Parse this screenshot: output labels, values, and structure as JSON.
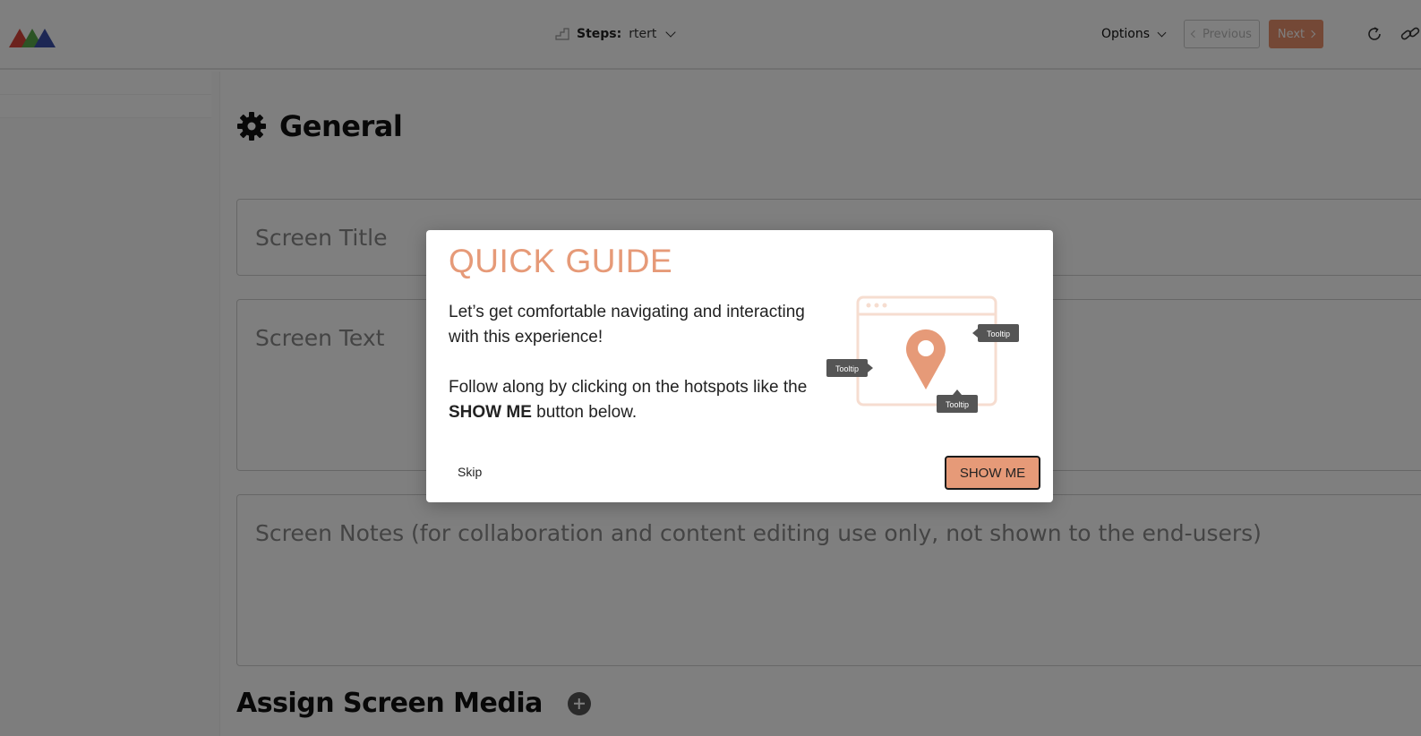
{
  "header": {
    "steps_label": "Steps:",
    "steps_value": "rtert",
    "options_label": "Options",
    "previous_label": "Previous",
    "next_label": "Next"
  },
  "main": {
    "section_title": "General",
    "screen_title_placeholder": "Screen Title",
    "screen_text_placeholder": "Screen Text",
    "screen_notes_placeholder": "Screen Notes (for collaboration and content editing use only, not shown to the end-users)",
    "media_title": "Assign Screen Media"
  },
  "guide": {
    "title": "QUICK GUIDE",
    "paragraph1": "Let’s get comfortable navigating and interacting with this experience!",
    "paragraph2_before": "Follow along by clicking on the hotspots like the ",
    "paragraph2_bold": "SHOW ME",
    "paragraph2_after": " button below.",
    "tooltip_label": "Tooltip",
    "skip_label": "Skip",
    "showme_label": "SHOW ME"
  },
  "colors": {
    "accent": "#e69a78",
    "next_button": "#e8916d",
    "overlay": "rgba(0,0,0,0.5)"
  },
  "icons": [
    "logo-icon",
    "steps-icon",
    "chevron-down-icon",
    "chevron-left-icon",
    "chevron-right-icon",
    "refresh-icon",
    "link-icon",
    "gear-icon",
    "plus-icon",
    "map-pin-icon"
  ]
}
